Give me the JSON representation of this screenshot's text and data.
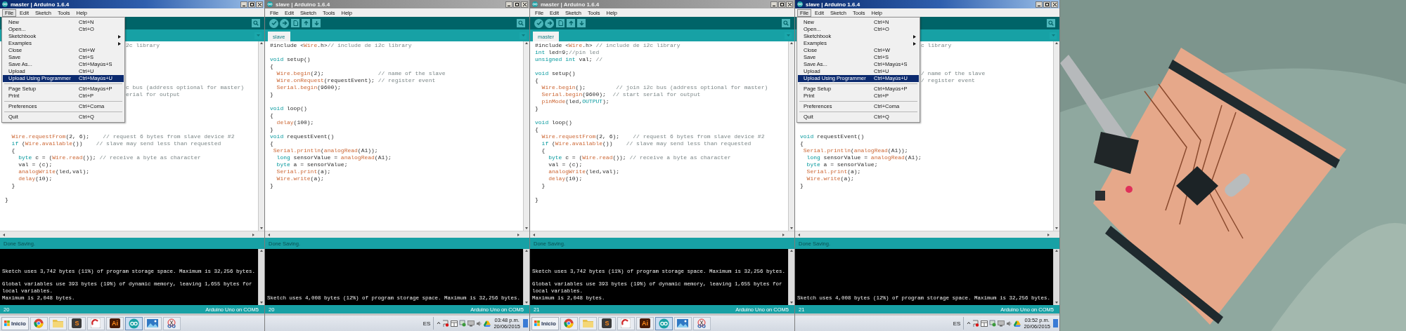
{
  "panels": [
    {
      "title": "master | Arduino 1.6.4",
      "active": true,
      "menubar": [
        {
          "label": "File",
          "selected": true
        },
        {
          "label": "Edit",
          "selected": false
        },
        {
          "label": "Sketch",
          "selected": false
        },
        {
          "label": "Tools",
          "selected": false
        },
        {
          "label": "Help",
          "selected": false
        }
      ],
      "file_menu": [
        {
          "kind": "item",
          "label": "New",
          "shortcut": "Ctrl+N",
          "selected": false
        },
        {
          "kind": "item",
          "label": "Open...",
          "shortcut": "Ctrl+O",
          "selected": false
        },
        {
          "kind": "submenu",
          "label": "Sketchbook",
          "selected": false
        },
        {
          "kind": "submenu",
          "label": "Examples",
          "selected": false
        },
        {
          "kind": "item",
          "label": "Close",
          "shortcut": "Ctrl+W",
          "selected": false
        },
        {
          "kind": "item",
          "label": "Save",
          "shortcut": "Ctrl+S",
          "selected": false
        },
        {
          "kind": "item",
          "label": "Save As...",
          "shortcut": "Ctrl+Mayús+S",
          "selected": false
        },
        {
          "kind": "item",
          "label": "Upload",
          "shortcut": "Ctrl+U",
          "selected": false
        },
        {
          "kind": "item",
          "label": "Upload Using Programmer",
          "shortcut": "Ctrl+Mayús+U",
          "selected": true
        },
        {
          "kind": "separator"
        },
        {
          "kind": "item",
          "label": "Page Setup",
          "shortcut": "Ctrl+Mayús+P",
          "selected": false
        },
        {
          "kind": "item",
          "label": "Print",
          "shortcut": "Ctrl+P",
          "selected": false
        },
        {
          "kind": "separator"
        },
        {
          "kind": "item",
          "label": "Preferences",
          "shortcut": "Ctrl+Coma",
          "selected": false
        },
        {
          "kind": "separator"
        },
        {
          "kind": "item",
          "label": "Quit",
          "shortcut": "Ctrl+Q",
          "selected": false
        }
      ],
      "lines": [
        {
          "kind": "partial",
          "segments": [
            {
              "text": "2c library",
              "kind": "comment"
            }
          ]
        },
        {
          "kind": "blank"
        },
        {
          "kind": "blank"
        },
        {
          "kind": "blank"
        },
        {
          "kind": "blank"
        },
        {
          "kind": "blank"
        },
        {
          "kind": "partial",
          "segments": [
            {
              "text": "c bus (address optional for master)",
              "kind": "comment"
            }
          ]
        },
        {
          "kind": "partial",
          "segments": [
            {
              "text": "erial for output",
              "kind": "comment"
            }
          ]
        },
        {
          "kind": "blank"
        },
        {
          "kind": "blank"
        },
        {
          "kind": "blank"
        },
        {
          "kind": "blank"
        },
        {
          "kind": "blank"
        },
        {
          "kind": "code",
          "segments": [
            {
              "text": "  Wire.requestFrom",
              "kind": "function"
            },
            {
              "text": "(2, 6);    ",
              "kind": "plain"
            },
            {
              "text": "// request 6 bytes from slave device #2",
              "kind": "comment"
            }
          ]
        },
        {
          "kind": "code",
          "segments": [
            {
              "text": "  if",
              "kind": "keyword"
            },
            {
              "text": " (",
              "kind": "plain"
            },
            {
              "text": "Wire.available",
              "kind": "function"
            },
            {
              "text": "())    ",
              "kind": "plain"
            },
            {
              "text": "// slave may send less than requested",
              "kind": "comment"
            }
          ]
        },
        {
          "kind": "code",
          "segments": [
            {
              "text": "  {",
              "kind": "plain"
            }
          ]
        },
        {
          "kind": "code",
          "segments": [
            {
              "text": "    byte",
              "kind": "keyword"
            },
            {
              "text": " c = (",
              "kind": "plain"
            },
            {
              "text": "Wire.read",
              "kind": "function"
            },
            {
              "text": "()); ",
              "kind": "plain"
            },
            {
              "text": "// receive a byte as character",
              "kind": "comment"
            }
          ]
        },
        {
          "kind": "code",
          "segments": [
            {
              "text": "    val = (c);",
              "kind": "plain"
            }
          ]
        },
        {
          "kind": "code",
          "segments": [
            {
              "text": "    analogWrite",
              "kind": "function"
            },
            {
              "text": "(led,val);",
              "kind": "plain"
            }
          ]
        },
        {
          "kind": "code",
          "segments": [
            {
              "text": "    delay",
              "kind": "function"
            },
            {
              "text": "(10);",
              "kind": "plain"
            }
          ]
        },
        {
          "kind": "code",
          "segments": [
            {
              "text": "  }",
              "kind": "plain"
            }
          ]
        },
        {
          "kind": "blank"
        },
        {
          "kind": "code",
          "segments": [
            {
              "text": "}",
              "kind": "plain"
            }
          ]
        }
      ],
      "status_message": "Done Saving.",
      "console": [
        {
          "text": "Sketch uses 3,742 bytes (11%) of program storage space. Maximum is 32,256 bytes.",
          "kind": "spaced"
        },
        {
          "text": "Global variables use 393 bytes (19%) of dynamic memory, leaving 1,655 bytes for local variables.",
          "kind": "spaced"
        },
        {
          "text": "Maximum is 2,048 bytes.",
          "kind": "line"
        }
      ],
      "line_number": "20",
      "board": "Arduino Uno on COM5",
      "taskbar": {
        "kind": "start",
        "start_label": "Inicio",
        "apps": [
          {
            "kind": "chrome",
            "active": false
          },
          {
            "kind": "folder",
            "active": false
          },
          {
            "kind": "tile",
            "glyph": "S",
            "active": false
          },
          {
            "kind": "eagle",
            "active": false
          },
          {
            "kind": "tile",
            "glyph": "Ai",
            "active": false
          },
          {
            "kind": "arduino",
            "active": true
          },
          {
            "kind": "photos",
            "active": false
          },
          {
            "kind": "snip",
            "active": false
          }
        ]
      }
    },
    {
      "title": "slave | Arduino 1.6.4",
      "active": false,
      "menubar": [
        {
          "label": "File",
          "selected": false
        },
        {
          "label": "Edit",
          "selected": false
        },
        {
          "label": "Sketch",
          "selected": false
        },
        {
          "label": "Tools",
          "selected": false
        },
        {
          "label": "Help",
          "selected": false
        }
      ],
      "tab_label": "slave",
      "lines": [
        {
          "kind": "code",
          "segments": [
            {
              "text": "#include <",
              "kind": "plain"
            },
            {
              "text": "Wire",
              "kind": "function"
            },
            {
              "text": ".h>",
              "kind": "plain"
            },
            {
              "text": "// include de i2c library",
              "kind": "comment"
            }
          ]
        },
        {
          "kind": "blank"
        },
        {
          "kind": "code",
          "segments": [
            {
              "text": "void",
              "kind": "keyword"
            },
            {
              "text": " setup()",
              "kind": "plain"
            }
          ]
        },
        {
          "kind": "code",
          "segments": [
            {
              "text": "{",
              "kind": "plain"
            }
          ]
        },
        {
          "kind": "code",
          "segments": [
            {
              "text": "  Wire.begin",
              "kind": "function"
            },
            {
              "text": "(2);                ",
              "kind": "plain"
            },
            {
              "text": "// name of the slave",
              "kind": "comment"
            }
          ]
        },
        {
          "kind": "code",
          "segments": [
            {
              "text": "  Wire.onRequest",
              "kind": "function"
            },
            {
              "text": "(requestEvent); ",
              "kind": "plain"
            },
            {
              "text": "// register event",
              "kind": "comment"
            }
          ]
        },
        {
          "kind": "code",
          "segments": [
            {
              "text": "  Serial.begin",
              "kind": "function"
            },
            {
              "text": "(9600);",
              "kind": "plain"
            }
          ]
        },
        {
          "kind": "code",
          "segments": [
            {
              "text": "}",
              "kind": "plain"
            }
          ]
        },
        {
          "kind": "blank"
        },
        {
          "kind": "code",
          "segments": [
            {
              "text": "void",
              "kind": "keyword"
            },
            {
              "text": " loop()",
              "kind": "plain"
            }
          ]
        },
        {
          "kind": "code",
          "segments": [
            {
              "text": "{",
              "kind": "plain"
            }
          ]
        },
        {
          "kind": "code",
          "segments": [
            {
              "text": "  delay",
              "kind": "function"
            },
            {
              "text": "(100);",
              "kind": "plain"
            }
          ]
        },
        {
          "kind": "code",
          "segments": [
            {
              "text": "}",
              "kind": "plain"
            }
          ]
        },
        {
          "kind": "code",
          "segments": [
            {
              "text": "void",
              "kind": "keyword"
            },
            {
              "text": " requestEvent()",
              "kind": "plain"
            }
          ]
        },
        {
          "kind": "code",
          "segments": [
            {
              "text": "{",
              "kind": "plain"
            }
          ]
        },
        {
          "kind": "code",
          "segments": [
            {
              "text": " Serial.println",
              "kind": "function"
            },
            {
              "text": "(",
              "kind": "plain"
            },
            {
              "text": "analogRead",
              "kind": "function"
            },
            {
              "text": "(A1));",
              "kind": "plain"
            }
          ]
        },
        {
          "kind": "code",
          "segments": [
            {
              "text": "  long",
              "kind": "keyword"
            },
            {
              "text": " sensorValue = ",
              "kind": "plain"
            },
            {
              "text": "analogRead",
              "kind": "function"
            },
            {
              "text": "(A1);",
              "kind": "plain"
            }
          ]
        },
        {
          "kind": "code",
          "segments": [
            {
              "text": "  byte",
              "kind": "keyword"
            },
            {
              "text": " a = sensorValue;",
              "kind": "plain"
            }
          ]
        },
        {
          "kind": "code",
          "segments": [
            {
              "text": "  Serial.print",
              "kind": "function"
            },
            {
              "text": "(a);",
              "kind": "plain"
            }
          ]
        },
        {
          "kind": "code",
          "segments": [
            {
              "text": "  Wire.write",
              "kind": "function"
            },
            {
              "text": "(a);",
              "kind": "plain"
            }
          ]
        },
        {
          "kind": "code",
          "segments": [
            {
              "text": "}",
              "kind": "plain"
            }
          ]
        }
      ],
      "status_message": "Done Saving.",
      "console": [
        {
          "text": "Sketch uses 4,008 bytes (12%) of program storage space. Maximum is 32,256 bytes.",
          "kind": "line"
        }
      ],
      "line_number": "20",
      "board": "Arduino Uno on COM5",
      "taskbar": {
        "kind": "tray",
        "language": "ES",
        "time": "03:48 p.m.",
        "date": "20/06/2015"
      }
    },
    {
      "title": "master | Arduino 1.6.4",
      "active": false,
      "menubar": [
        {
          "label": "File",
          "selected": false
        },
        {
          "label": "Edit",
          "selected": false
        },
        {
          "label": "Sketch",
          "selected": false
        },
        {
          "label": "Tools",
          "selected": false
        },
        {
          "label": "Help",
          "selected": false
        }
      ],
      "tab_label": "master",
      "lines": [
        {
          "kind": "code",
          "segments": [
            {
              "text": "#include <",
              "kind": "plain"
            },
            {
              "text": "Wire",
              "kind": "function"
            },
            {
              "text": ".h> ",
              "kind": "plain"
            },
            {
              "text": "// include de i2c library",
              "kind": "comment"
            }
          ]
        },
        {
          "kind": "code",
          "segments": [
            {
              "text": "int",
              "kind": "keyword"
            },
            {
              "text": " led=9;",
              "kind": "plain"
            },
            {
              "text": "//pin led",
              "kind": "comment"
            }
          ]
        },
        {
          "kind": "code",
          "segments": [
            {
              "text": "unsigned int",
              "kind": "keyword"
            },
            {
              "text": " val; ",
              "kind": "plain"
            },
            {
              "text": "//",
              "kind": "comment"
            }
          ]
        },
        {
          "kind": "blank"
        },
        {
          "kind": "code",
          "segments": [
            {
              "text": "void",
              "kind": "keyword"
            },
            {
              "text": " setup()",
              "kind": "plain"
            }
          ]
        },
        {
          "kind": "code",
          "segments": [
            {
              "text": "{",
              "kind": "plain"
            }
          ]
        },
        {
          "kind": "code",
          "segments": [
            {
              "text": "  Wire.begin",
              "kind": "function"
            },
            {
              "text": "();         ",
              "kind": "plain"
            },
            {
              "text": "// join i2c bus (address optional for master)",
              "kind": "comment"
            }
          ]
        },
        {
          "kind": "code",
          "segments": [
            {
              "text": "  Serial.begin",
              "kind": "function"
            },
            {
              "text": "(9600);  ",
              "kind": "plain"
            },
            {
              "text": "// start serial for output",
              "kind": "comment"
            }
          ]
        },
        {
          "kind": "code",
          "segments": [
            {
              "text": "  pinMode",
              "kind": "function"
            },
            {
              "text": "(led,",
              "kind": "plain"
            },
            {
              "text": "OUTPUT",
              "kind": "keyword"
            },
            {
              "text": ");",
              "kind": "plain"
            }
          ]
        },
        {
          "kind": "code",
          "segments": [
            {
              "text": "}",
              "kind": "plain"
            }
          ]
        },
        {
          "kind": "blank"
        },
        {
          "kind": "code",
          "segments": [
            {
              "text": "void",
              "kind": "keyword"
            },
            {
              "text": " loop()",
              "kind": "plain"
            }
          ]
        },
        {
          "kind": "code",
          "segments": [
            {
              "text": "{",
              "kind": "plain"
            }
          ]
        },
        {
          "kind": "code",
          "segments": [
            {
              "text": "  Wire.requestFrom",
              "kind": "function"
            },
            {
              "text": "(2, 6);    ",
              "kind": "plain"
            },
            {
              "text": "// request 6 bytes from slave device #2",
              "kind": "comment"
            }
          ]
        },
        {
          "kind": "code",
          "segments": [
            {
              "text": "  if",
              "kind": "keyword"
            },
            {
              "text": " (",
              "kind": "plain"
            },
            {
              "text": "Wire.available",
              "kind": "function"
            },
            {
              "text": "())    ",
              "kind": "plain"
            },
            {
              "text": "// slave may send less than requested",
              "kind": "comment"
            }
          ]
        },
        {
          "kind": "code",
          "segments": [
            {
              "text": "  {",
              "kind": "plain"
            }
          ]
        },
        {
          "kind": "code",
          "segments": [
            {
              "text": "    byte",
              "kind": "keyword"
            },
            {
              "text": " c = (",
              "kind": "plain"
            },
            {
              "text": "Wire.read",
              "kind": "function"
            },
            {
              "text": "()); ",
              "kind": "plain"
            },
            {
              "text": "// receive a byte as character",
              "kind": "comment"
            }
          ]
        },
        {
          "kind": "code",
          "segments": [
            {
              "text": "    val = (c);",
              "kind": "plain"
            }
          ]
        },
        {
          "kind": "code",
          "segments": [
            {
              "text": "    analogWrite",
              "kind": "function"
            },
            {
              "text": "(led,val);",
              "kind": "plain"
            }
          ]
        },
        {
          "kind": "code",
          "segments": [
            {
              "text": "    delay",
              "kind": "function"
            },
            {
              "text": "(10);",
              "kind": "plain"
            }
          ]
        },
        {
          "kind": "code",
          "segments": [
            {
              "text": "  }",
              "kind": "plain"
            }
          ]
        },
        {
          "kind": "blank"
        },
        {
          "kind": "code",
          "segments": [
            {
              "text": "}",
              "kind": "plain"
            }
          ]
        }
      ],
      "status_message": "Done Saving.",
      "console": [
        {
          "text": "Sketch uses 3,742 bytes (11%) of program storage space. Maximum is 32,256 bytes.",
          "kind": "spaced"
        },
        {
          "text": "Global variables use 393 bytes (19%) of dynamic memory, leaving 1,655 bytes for local variables.",
          "kind": "spaced"
        },
        {
          "text": "Maximum is 2,048 bytes.",
          "kind": "line"
        }
      ],
      "line_number": "21",
      "board": "Arduino Uno on COM5",
      "taskbar": {
        "kind": "start",
        "start_label": "Inicio",
        "apps": [
          {
            "kind": "chrome",
            "active": false
          },
          {
            "kind": "folder",
            "active": false
          },
          {
            "kind": "tile",
            "glyph": "S",
            "active": false
          },
          {
            "kind": "eagle",
            "active": false
          },
          {
            "kind": "tile",
            "glyph": "Ai",
            "active": false
          },
          {
            "kind": "arduino",
            "active": true
          },
          {
            "kind": "photos",
            "active": false
          },
          {
            "kind": "snip",
            "active": false
          }
        ]
      }
    },
    {
      "title": "slave | Arduino 1.6.4",
      "active": true,
      "menubar": [
        {
          "label": "File",
          "selected": true
        },
        {
          "label": "Edit",
          "selected": false
        },
        {
          "label": "Sketch",
          "selected": false
        },
        {
          "label": "Tools",
          "selected": false
        },
        {
          "label": "Help",
          "selected": false
        }
      ],
      "file_menu": [
        {
          "kind": "item",
          "label": "New",
          "shortcut": "Ctrl+N",
          "selected": false
        },
        {
          "kind": "item",
          "label": "Open...",
          "shortcut": "Ctrl+O",
          "selected": false
        },
        {
          "kind": "submenu",
          "label": "Sketchbook",
          "selected": false
        },
        {
          "kind": "submenu",
          "label": "Examples",
          "selected": false
        },
        {
          "kind": "item",
          "label": "Close",
          "shortcut": "Ctrl+W",
          "selected": false
        },
        {
          "kind": "item",
          "label": "Save",
          "shortcut": "Ctrl+S",
          "selected": false
        },
        {
          "kind": "item",
          "label": "Save As...",
          "shortcut": "Ctrl+Mayús+S",
          "selected": false
        },
        {
          "kind": "item",
          "label": "Upload",
          "shortcut": "Ctrl+U",
          "selected": false
        },
        {
          "kind": "item",
          "label": "Upload Using Programmer",
          "shortcut": "Ctrl+Mayús+U",
          "selected": true
        },
        {
          "kind": "separator"
        },
        {
          "kind": "item",
          "label": "Page Setup",
          "shortcut": "Ctrl+Mayús+P",
          "selected": false
        },
        {
          "kind": "item",
          "label": "Print",
          "shortcut": "Ctrl+P",
          "selected": false
        },
        {
          "kind": "separator"
        },
        {
          "kind": "item",
          "label": "Preferences",
          "shortcut": "Ctrl+Coma",
          "selected": false
        },
        {
          "kind": "separator"
        },
        {
          "kind": "item",
          "label": "Quit",
          "shortcut": "Ctrl+Q",
          "selected": false
        }
      ],
      "lines": [
        {
          "kind": "partial",
          "segments": [
            {
              "text": "c library",
              "kind": "comment"
            }
          ]
        },
        {
          "kind": "blank"
        },
        {
          "kind": "blank"
        },
        {
          "kind": "blank"
        },
        {
          "kind": "partial",
          "segments": [
            {
              "text": "/ name of the slave",
              "kind": "comment"
            }
          ]
        },
        {
          "kind": "partial",
          "segments": [
            {
              "text": "/ register event",
              "kind": "comment"
            }
          ]
        },
        {
          "kind": "blank"
        },
        {
          "kind": "blank"
        },
        {
          "kind": "blank"
        },
        {
          "kind": "blank"
        },
        {
          "kind": "blank"
        },
        {
          "kind": "blank"
        },
        {
          "kind": "blank"
        },
        {
          "kind": "code",
          "segments": [
            {
              "text": "void",
              "kind": "keyword"
            },
            {
              "text": " requestEvent()",
              "kind": "plain"
            }
          ]
        },
        {
          "kind": "code",
          "segments": [
            {
              "text": "{",
              "kind": "plain"
            }
          ]
        },
        {
          "kind": "code",
          "segments": [
            {
              "text": " Serial.println",
              "kind": "function"
            },
            {
              "text": "(",
              "kind": "plain"
            },
            {
              "text": "analogRead",
              "kind": "function"
            },
            {
              "text": "(A1));",
              "kind": "plain"
            }
          ]
        },
        {
          "kind": "code",
          "segments": [
            {
              "text": "  long",
              "kind": "keyword"
            },
            {
              "text": " sensorValue = ",
              "kind": "plain"
            },
            {
              "text": "analogRead",
              "kind": "function"
            },
            {
              "text": "(A1);",
              "kind": "plain"
            }
          ]
        },
        {
          "kind": "code",
          "segments": [
            {
              "text": "  byte",
              "kind": "keyword"
            },
            {
              "text": " a = sensorValue;",
              "kind": "plain"
            }
          ]
        },
        {
          "kind": "code",
          "segments": [
            {
              "text": "  Serial.print",
              "kind": "function"
            },
            {
              "text": "(a);",
              "kind": "plain"
            }
          ]
        },
        {
          "kind": "code",
          "segments": [
            {
              "text": "  Wire.write",
              "kind": "function"
            },
            {
              "text": "(a);",
              "kind": "plain"
            }
          ]
        },
        {
          "kind": "code",
          "segments": [
            {
              "text": "}",
              "kind": "plain"
            }
          ]
        }
      ],
      "status_message": "Done Saving.",
      "console": [
        {
          "text": "Sketch uses 4,008 bytes (12%) of program storage space. Maximum is 32,256 bytes.",
          "kind": "line"
        }
      ],
      "line_number": "21",
      "board": "Arduino Uno on COM5",
      "taskbar": {
        "kind": "tray",
        "language": "ES",
        "time": "03:52 p.m.",
        "date": "20/06/2015"
      }
    }
  ]
}
